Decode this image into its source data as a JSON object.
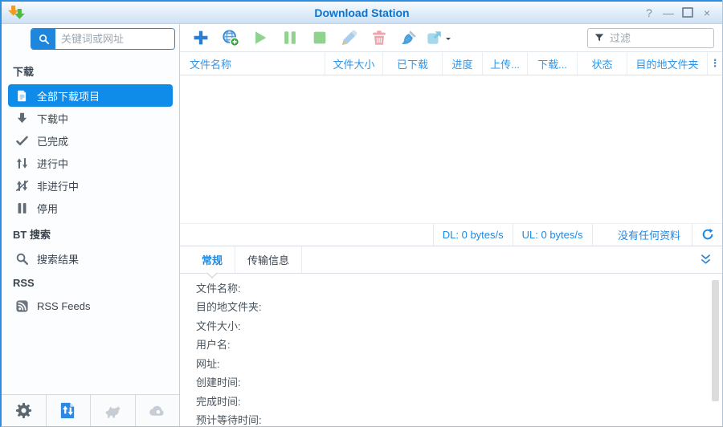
{
  "window": {
    "title": "Download Station",
    "controls": [
      {
        "name": "help-icon",
        "glyph": "?"
      },
      {
        "name": "minimize-icon",
        "glyph": "—"
      },
      {
        "name": "maximize-icon",
        "glyph": ""
      },
      {
        "name": "close-icon",
        "glyph": "×"
      }
    ]
  },
  "sidebar": {
    "search_placeholder": "关键词或网址",
    "nav": [
      {
        "type": "header",
        "name": "section-download",
        "label": "下载"
      },
      {
        "type": "item",
        "name": "sidebar-item-all-downloads",
        "label": "全部下载项目",
        "icon": "document-icon",
        "selected": true
      },
      {
        "type": "item",
        "name": "sidebar-item-downloading",
        "label": "下载中",
        "icon": "down-arrow-icon"
      },
      {
        "type": "item",
        "name": "sidebar-item-completed",
        "label": "已完成",
        "icon": "check-icon"
      },
      {
        "type": "item",
        "name": "sidebar-item-active",
        "label": "进行中",
        "icon": "active-arrows-icon"
      },
      {
        "type": "item",
        "name": "sidebar-item-inactive",
        "label": "非进行中",
        "icon": "inactive-arrows-icon"
      },
      {
        "type": "item",
        "name": "sidebar-item-stopped",
        "label": "停用",
        "icon": "pause-grey-icon"
      },
      {
        "type": "header",
        "name": "section-bt-search",
        "label": "BT 搜索"
      },
      {
        "type": "item",
        "name": "sidebar-item-search-results",
        "label": "搜索结果",
        "icon": "search-grey-icon"
      },
      {
        "type": "header",
        "name": "section-rss",
        "label": "RSS"
      },
      {
        "type": "item",
        "name": "sidebar-item-rss-feeds",
        "label": "RSS Feeds",
        "icon": "rss-icon"
      }
    ],
    "footer": [
      {
        "name": "settings-button",
        "icon": "gear-icon"
      },
      {
        "name": "download-station-button",
        "icon": "download-manager-icon",
        "active": true
      },
      {
        "name": "browser-extension-button",
        "icon": "dog-icon"
      },
      {
        "name": "cloud-service-button",
        "icon": "cloud-icon"
      }
    ]
  },
  "toolbar": {
    "buttons": [
      {
        "name": "add-task-button",
        "icon": "plus-icon"
      },
      {
        "name": "add-url-button",
        "icon": "globe-add-icon"
      },
      {
        "name": "resume-button",
        "icon": "play-icon"
      },
      {
        "name": "pause-button",
        "icon": "pause-green-icon"
      },
      {
        "name": "stop-button",
        "icon": "stop-icon"
      },
      {
        "name": "edit-button",
        "icon": "pencil-icon"
      },
      {
        "name": "delete-button",
        "icon": "trash-icon"
      },
      {
        "name": "clear-button",
        "icon": "brush-icon"
      },
      {
        "name": "share-button",
        "icon": "share-icon",
        "caret": true
      }
    ],
    "filter_placeholder": "过滤"
  },
  "table": {
    "columns": [
      "文件名称",
      "文件大小",
      "已下载",
      "进度",
      "上传...",
      "下载...",
      "状态",
      "目的地文件夹"
    ],
    "menu_glyph": "⋮",
    "rows": []
  },
  "statusbar": {
    "download_speed": "DL: 0 bytes/s",
    "upload_speed": "UL: 0 bytes/s",
    "empty_message": "没有任何资料"
  },
  "details": {
    "tabs": [
      {
        "label": "常规",
        "active": true
      },
      {
        "label": "传输信息"
      }
    ],
    "fields": [
      "文件名称:",
      "目的地文件夹:",
      "文件大小:",
      "用户名:",
      "网址:",
      "创建时间:",
      "完成时间:",
      "预计等待时间:"
    ]
  },
  "colors": {
    "accent_blue": "#0f8ce9",
    "title_blue": "#0c73cf",
    "header_text_blue": "#2e96ea",
    "status_text_blue": "#1e88e5",
    "toolbar_green": "#8fd38f",
    "toolbar_red": "#f0a3ab"
  }
}
